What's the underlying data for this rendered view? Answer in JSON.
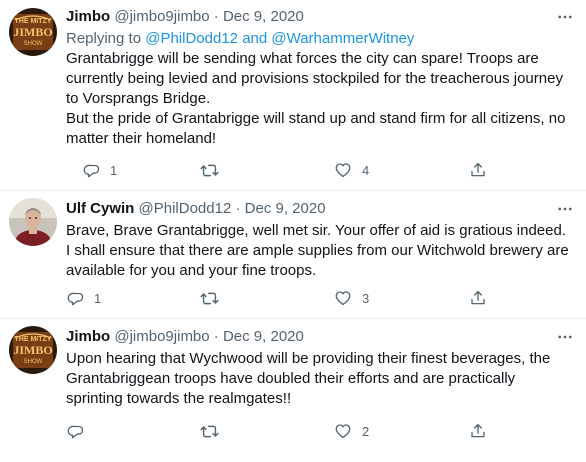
{
  "tweets": [
    {
      "name": "Jimbo",
      "handle": "@jimbo9jimbo",
      "separator": "·",
      "date": "Dec 9, 2020",
      "replying_prefix": "Replying to",
      "mention_1": "@PhilDodd12",
      "and_word": "and",
      "mention_2": "@WarhammerWitney",
      "paragraph_1": "Grantabrigge will be sending what forces the city can spare! Troops are currently being levied and provisions stockpiled for the treacherous journey to Vorsprangs Bridge.",
      "paragraph_2": "But the pride of Grantabrigge will stand up and stand firm for all citizens, no matter their homeland!",
      "reply_count": "1",
      "retweet_count": "",
      "like_count": "4",
      "avatar_text_top": "THE MITZY",
      "avatar_text_mid": "JIMBO",
      "avatar_text_bot": "SHOW",
      "avatar_icon": "jimbo-logo-avatar"
    },
    {
      "name": "Ulf Cywin",
      "handle": "@PhilDodd12",
      "separator": "·",
      "date": "Dec 9, 2020",
      "paragraph_1": "Brave, Brave Grantabrigge, well met sir. Your offer of aid is gratious indeed.",
      "paragraph_2": "I shall ensure that there are ample supplies from our Witchwold brewery are available for you and your fine troops.",
      "reply_count": "1",
      "retweet_count": "",
      "like_count": "3",
      "avatar_icon": "person-photo-avatar"
    },
    {
      "name": "Jimbo",
      "handle": "@jimbo9jimbo",
      "separator": "·",
      "date": "Dec 9, 2020",
      "paragraph_1": "Upon hearing that Wychwood will be providing their finest beverages, the Grantabriggean troops have doubled their efforts and are practically sprinting towards the realmgates!!",
      "reply_count": "",
      "retweet_count": "",
      "like_count": "2",
      "avatar_text_top": "THE MITZY",
      "avatar_text_mid": "JIMBO",
      "avatar_text_bot": "SHOW",
      "avatar_icon": "jimbo-logo-avatar"
    }
  ],
  "icons": {
    "reply": "reply-icon",
    "retweet": "retweet-icon",
    "like": "heart-icon",
    "share": "share-icon",
    "more": "more-options-icon"
  },
  "colors": {
    "text": "#0f1419",
    "secondary": "#536471",
    "link": "#1b95e0",
    "divider": "#e6ecf0",
    "avatar_logo_bg": "#7a3e14",
    "avatar_logo_text": "#f2c46b"
  }
}
